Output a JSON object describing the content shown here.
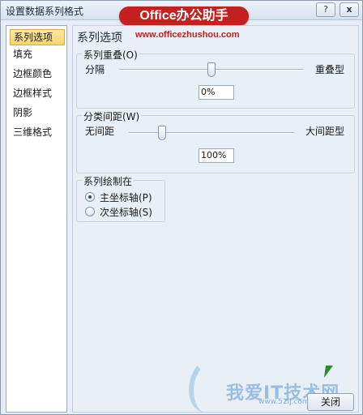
{
  "window": {
    "title": "设置数据系列格式"
  },
  "titlebar": {
    "help_label": "?",
    "close_label": "x"
  },
  "brand": {
    "badge": "Office办公助手",
    "url": "www.officezhushou.com"
  },
  "nav": {
    "items": [
      {
        "label": "系列选项",
        "active": true
      },
      {
        "label": "填充",
        "active": false
      },
      {
        "label": "边框颜色",
        "active": false
      },
      {
        "label": "边框样式",
        "active": false
      },
      {
        "label": "阴影",
        "active": false
      },
      {
        "label": "三维格式",
        "active": false
      }
    ]
  },
  "content": {
    "section_title": "系列选项",
    "overlap": {
      "label": "系列重叠(O)",
      "left_label": "分隔",
      "right_label": "重叠型",
      "value": "0%",
      "slider_fraction": 0.5
    },
    "gap": {
      "label": "分类间距(W)",
      "left_label": "无间距",
      "right_label": "大间距型",
      "value": "100%",
      "slider_fraction": 0.2
    },
    "axis": {
      "label": "系列绘制在",
      "options": [
        {
          "label": "主坐标轴(P)",
          "selected": true
        },
        {
          "label": "次坐标轴(S)",
          "selected": false
        }
      ]
    }
  },
  "footer": {
    "close_label": "关闭"
  },
  "watermark": {
    "text": "我爱IT技术网",
    "url": "www.52ij.com"
  },
  "colors": {
    "accent": "#f7d36a",
    "brand": "#c42020",
    "cursor": "#2a8a2a"
  }
}
